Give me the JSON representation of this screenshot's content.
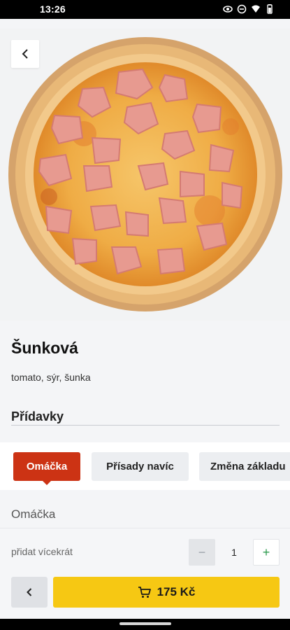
{
  "status_bar": {
    "time": "13:26",
    "icons": [
      "eye-icon",
      "dnd-icon",
      "wifi-icon",
      "battery-icon"
    ]
  },
  "product": {
    "image": "pizza-ham-photo",
    "title": "Šunková",
    "description": "tomato, sýr, šunka"
  },
  "addons": {
    "heading": "Přídavky",
    "tabs": [
      {
        "label": "Omáčka",
        "active": true
      },
      {
        "label": "Přísady navíc",
        "active": false
      },
      {
        "label": "Změna základu",
        "active": false
      }
    ],
    "section_label": "Omáčka"
  },
  "quantity": {
    "label": "přidat vícekrát",
    "minus": "−",
    "value": "1",
    "plus": "+"
  },
  "footer": {
    "back_icon": "chevron-left-icon",
    "cart_icon": "cart-icon",
    "add_to_cart_label": "175 Kč"
  },
  "colors": {
    "accent_red": "#cc3314",
    "cart_yellow": "#f6c813",
    "plus_green": "#2e9b4f"
  }
}
